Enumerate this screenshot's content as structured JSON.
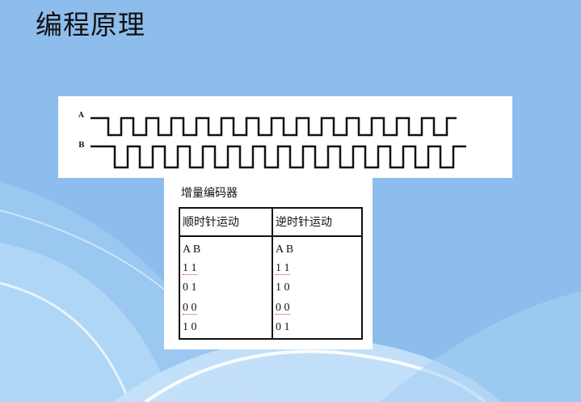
{
  "slide": {
    "title": "编程原理"
  },
  "waveform": {
    "channel_a_label": "A",
    "channel_b_label": "B"
  },
  "encoder_table": {
    "caption": "增量编码器",
    "headers": [
      "顺时针运动",
      "逆时针运动"
    ],
    "clockwise": [
      "A B",
      "1 1",
      "0 1",
      "0 0",
      "1 0"
    ],
    "counterclockwise": [
      "A B",
      "1 1",
      "1 0",
      "0 0",
      "0 1"
    ]
  }
}
